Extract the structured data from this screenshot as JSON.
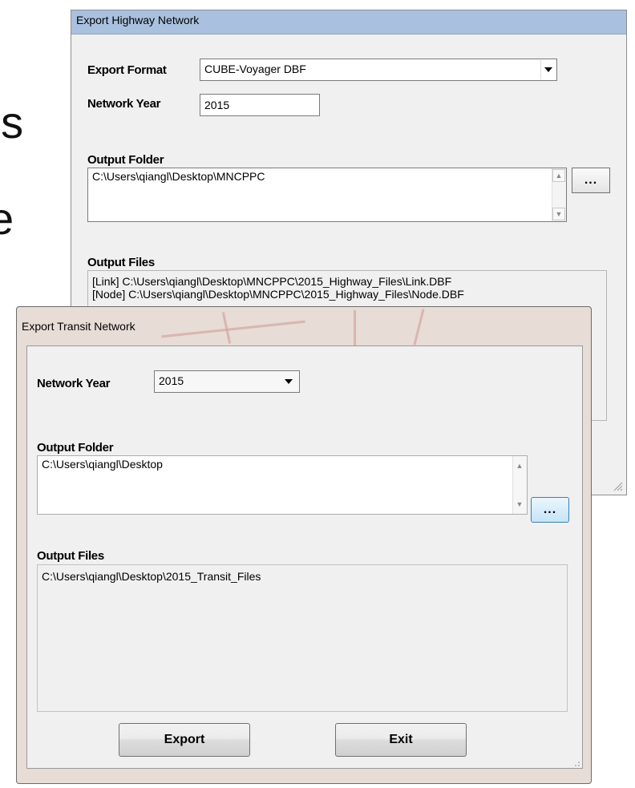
{
  "background_fragments": {
    "line1": "ns",
    "line2": "e"
  },
  "highway_window": {
    "title": "Export Highway Network",
    "export_format_label": "Export Format",
    "export_format_value": "CUBE-Voyager DBF",
    "network_year_label": "Network Year",
    "network_year_value": "2015",
    "output_folder_label": "Output Folder",
    "output_folder_value": "C:\\Users\\qiangl\\Desktop\\MNCPPC",
    "browse_label": "...",
    "output_files_label": "Output Files",
    "output_files": [
      "[Link] C:\\Users\\qiangl\\Desktop\\MNCPPC\\2015_Highway_Files\\Link.DBF",
      "[Node] C:\\Users\\qiangl\\Desktop\\MNCPPC\\2015_Highway_Files\\Node.DBF"
    ]
  },
  "transit_window": {
    "title": "Export Transit Network",
    "network_year_label": "Network Year",
    "network_year_value": "2015",
    "output_folder_label": "Output Folder",
    "output_folder_value": "C:\\Users\\qiangl\\Desktop",
    "browse_label": "...",
    "output_files_label": "Output Files",
    "output_files_value": "C:\\Users\\qiangl\\Desktop\\2015_Transit_Files",
    "export_button": "Export",
    "exit_button": "Exit"
  },
  "colors": {
    "highway_titlebar": "#a9c1df",
    "transit_titlebar": "#e7dcd6",
    "window_body": "#f0f0f0",
    "browse_highlight": "#3c7fb1"
  }
}
